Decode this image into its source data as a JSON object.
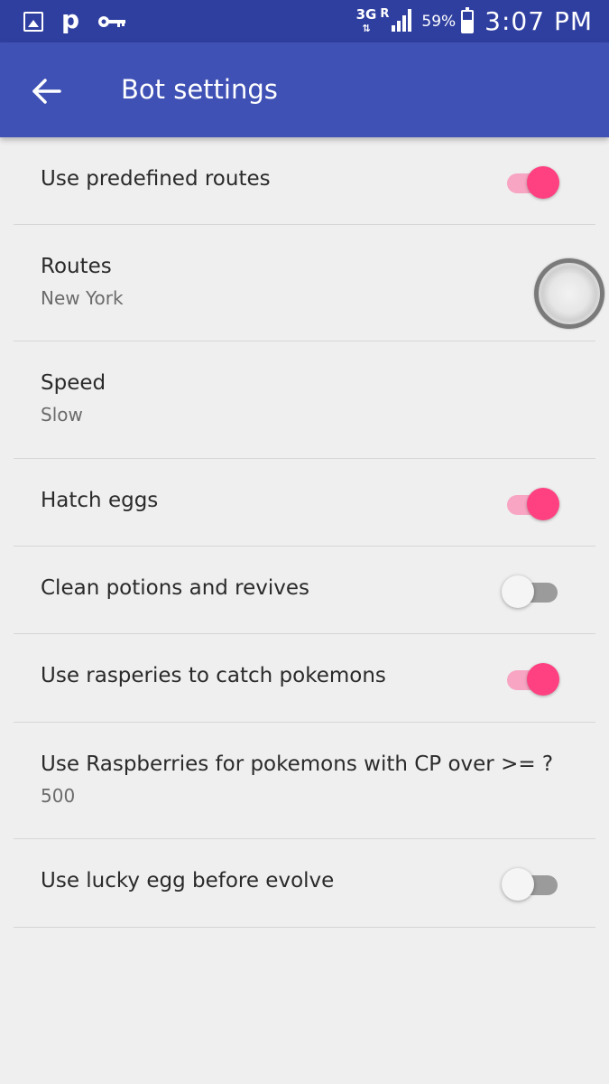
{
  "status_bar": {
    "network": "3G",
    "network_arrows": "⇅",
    "roaming": "R",
    "battery_percent": "59%",
    "battery_level": 0.59,
    "time": "3:07 PM",
    "icons": [
      "gallery-icon",
      "p-icon",
      "key-icon",
      "signal-icon",
      "battery-icon"
    ],
    "p_glyph": "p"
  },
  "app_bar": {
    "title": "Bot settings",
    "back_icon": "arrow-left-icon"
  },
  "colors": {
    "status_bar": "#2f3fa0",
    "app_bar": "#3f51b5",
    "accent": "#ff4081",
    "background": "#efefef"
  },
  "settings": [
    {
      "title": "Use predefined routes",
      "type": "switch",
      "checked": true
    },
    {
      "title": "Routes",
      "summary": "New York",
      "type": "list"
    },
    {
      "title": "Speed",
      "summary": "Slow",
      "type": "list"
    },
    {
      "title": "Hatch eggs",
      "type": "switch",
      "checked": true
    },
    {
      "title": "Clean potions and revives",
      "type": "switch",
      "checked": false
    },
    {
      "title": "Use rasperies to catch pokemons",
      "type": "switch",
      "checked": true
    },
    {
      "title": "Use Raspberries for pokemons with CP over >= ?",
      "summary": "500",
      "type": "edit"
    },
    {
      "title": "Use lucky egg before evolve",
      "type": "switch",
      "checked": false
    }
  ]
}
